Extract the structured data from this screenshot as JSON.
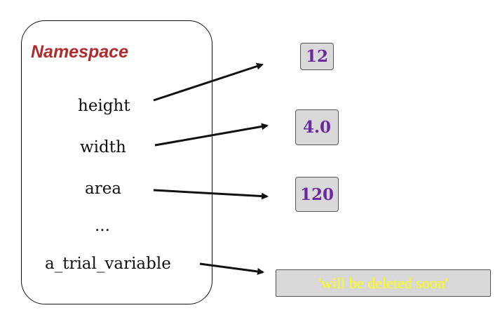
{
  "namespace": {
    "title": "Namespace",
    "variables": [
      {
        "name": "height",
        "value": "12",
        "value_color": "#6a2a9c"
      },
      {
        "name": "width",
        "value": "4.0",
        "value_color": "#6a2a9c"
      },
      {
        "name": "area",
        "value": "120",
        "value_color": "#6a2a9c"
      },
      {
        "name": "...",
        "value": null
      },
      {
        "name": "a_trial_variable",
        "value": "'will be deleted soon'",
        "value_color": "#ffff00"
      }
    ]
  },
  "colors": {
    "title": "#b22a2a",
    "value_box_bg": "#d9d9d9",
    "arrow": "#111111"
  }
}
